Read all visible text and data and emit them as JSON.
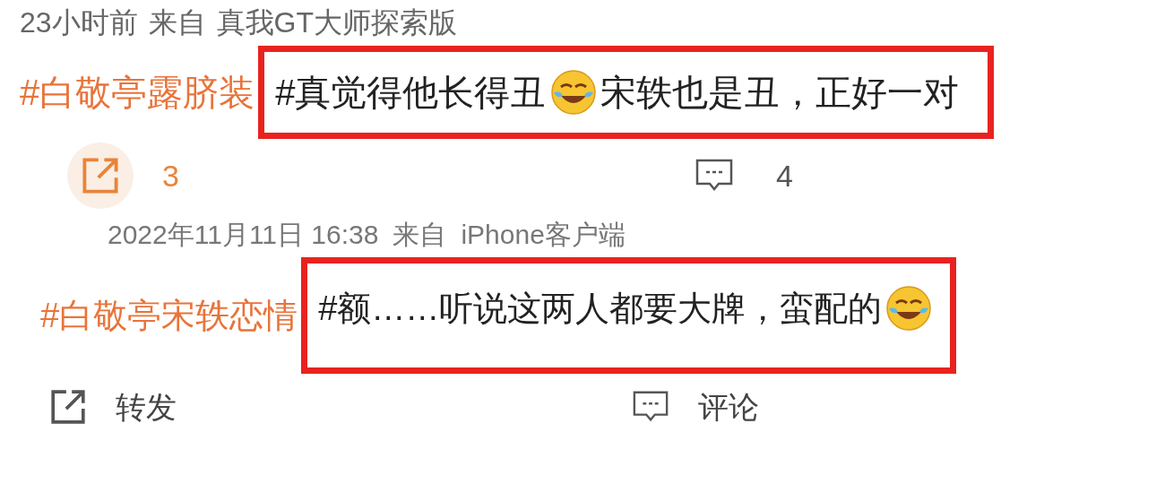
{
  "post_meta": {
    "time": "23小时前",
    "source_label": "来自",
    "device": "真我GT大师探索版"
  },
  "first_comment": {
    "hashtag": "#白敬亭露脐装",
    "segments": [
      {
        "kind": "text",
        "text": "#真觉得他长得丑"
      },
      {
        "kind": "emoji"
      },
      {
        "kind": "text",
        "text": "宋轶也是丑，正好一对"
      }
    ]
  },
  "first_actions": [
    {
      "kind": "repost",
      "count": "3",
      "highlighted": true
    },
    {
      "kind": "comment",
      "count": "4",
      "highlighted": false
    }
  ],
  "second_meta": {
    "date": "2022年11月11日 16:38",
    "source_label": "来自",
    "device": "iPhone客户端"
  },
  "second_comment": {
    "hashtag": "#白敬亭宋轶恋情",
    "segments": [
      {
        "kind": "text",
        "text": "#额……听说这两人都要大牌，蛮配的"
      },
      {
        "kind": "emoji"
      }
    ]
  },
  "bottom_actions": [
    {
      "kind": "repost",
      "label": "转发"
    },
    {
      "kind": "comment",
      "label": "评论"
    }
  ]
}
